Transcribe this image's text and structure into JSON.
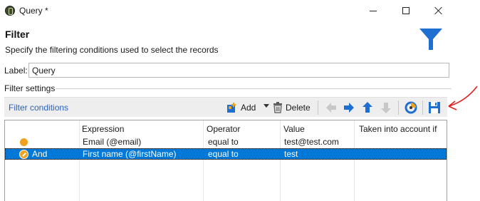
{
  "window": {
    "title": "Query *"
  },
  "header": {
    "title": "Filter",
    "subtitle": "Specify the filtering conditions used to select the records"
  },
  "label_field": {
    "caption": "Label:",
    "value": "Query"
  },
  "section": {
    "title": "Filter settings"
  },
  "toolbar": {
    "link_label": "Filter conditions",
    "add_label": "Add",
    "delete_label": "Delete"
  },
  "grid": {
    "columns": [
      "Expression",
      "Operator",
      "Value",
      "Taken into account if"
    ],
    "rows": [
      {
        "logic": "",
        "expression": "Email (@email)",
        "operator": "equal to",
        "value": "test@test.com",
        "condition": ""
      },
      {
        "logic": "And",
        "expression": "First name (@firstName)",
        "operator": "equal to",
        "value": "test",
        "condition": ""
      }
    ]
  },
  "colors": {
    "accent": "#2b63b9",
    "selection": "#0078d7",
    "funnel": "#1e6fd2",
    "status_dot": "#f0a21c",
    "annotation": "#e02020"
  }
}
